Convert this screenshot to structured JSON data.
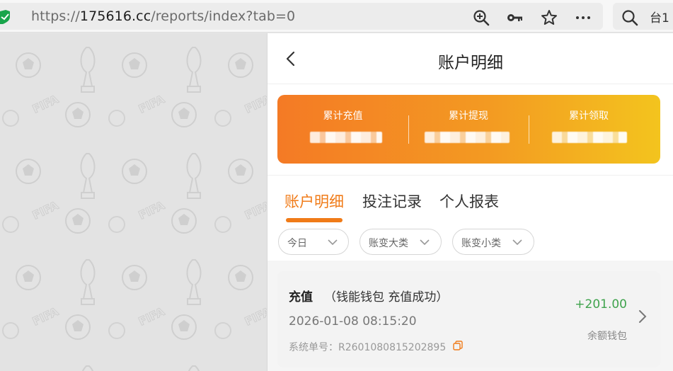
{
  "browser": {
    "url_prefix": "https://",
    "url_domain": "175616.cc",
    "url_path": "/reports/index?tab=0",
    "search_text": "台1",
    "icons": [
      "shield-icon",
      "zoom-in-icon",
      "key-icon",
      "star-icon",
      "more-icon",
      "search-icon"
    ]
  },
  "header": {
    "title": "账户明细",
    "back_icon": "back-icon"
  },
  "summary": {
    "stats": [
      {
        "label": "累计充值"
      },
      {
        "label": "累计提现"
      },
      {
        "label": "累计领取"
      }
    ],
    "gradient_start": "#f47a25",
    "gradient_end": "#f3c41e"
  },
  "tabs": [
    {
      "label": "账户明细",
      "active": true
    },
    {
      "label": "投注记录",
      "active": false
    },
    {
      "label": "个人报表",
      "active": false
    }
  ],
  "filters": [
    {
      "label": "今日"
    },
    {
      "label": "账变大类"
    },
    {
      "label": "账变小类"
    }
  ],
  "record": {
    "type": "充值",
    "desc": "（钱能钱包 充值成功）",
    "time": "2026-01-08 08:15:20",
    "order_label": "系统单号：R2601080815202895",
    "amount": "+201.00",
    "wallet": "余额钱包"
  },
  "colors": {
    "accent": "#f07b18",
    "positive": "#3fa34d"
  }
}
